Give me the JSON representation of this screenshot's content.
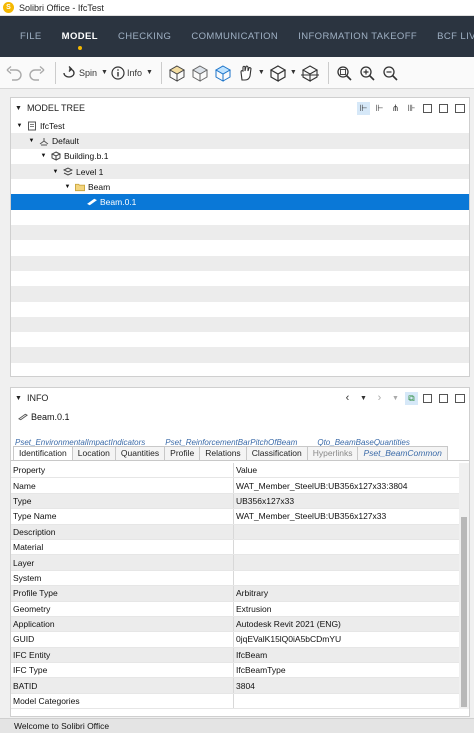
{
  "window": {
    "app_icon_letter": "S",
    "title": "Solibri Office - IfcTest"
  },
  "menu": {
    "items": [
      {
        "label": "FILE",
        "active": false
      },
      {
        "label": "MODEL",
        "active": true
      },
      {
        "label": "CHECKING",
        "active": false
      },
      {
        "label": "COMMUNICATION",
        "active": false
      },
      {
        "label": "INFORMATION TAKEOFF",
        "active": false
      },
      {
        "label": "BCF LIVE CONN",
        "active": false
      }
    ]
  },
  "toolbar": {
    "spin_label": "Spin",
    "info_label": "Info"
  },
  "model_tree": {
    "header": "MODEL TREE",
    "items": [
      {
        "label": "IfcTest",
        "depth": 0,
        "icon": "project-icon"
      },
      {
        "label": "Default",
        "depth": 1,
        "icon": "site-icon"
      },
      {
        "label": "Building.b.1",
        "depth": 2,
        "icon": "building-icon"
      },
      {
        "label": "Level 1",
        "depth": 3,
        "icon": "level-icon"
      },
      {
        "label": "Beam",
        "depth": 4,
        "icon": "folder-icon"
      },
      {
        "label": "Beam.0.1",
        "depth": 5,
        "icon": "beam-icon",
        "selected": true
      }
    ]
  },
  "info": {
    "header": "INFO",
    "selected_name": "Beam.0.1",
    "tabs_row1": [
      "Pset_EnvironmentalImpactIndicators",
      "Pset_ReinforcementBarPitchOfBeam",
      "Qto_BeamBaseQuantities"
    ],
    "tabs_row2": [
      {
        "label": "Identification",
        "style": "active"
      },
      {
        "label": "Location",
        "style": "normal"
      },
      {
        "label": "Quantities",
        "style": "normal"
      },
      {
        "label": "Profile",
        "style": "normal"
      },
      {
        "label": "Relations",
        "style": "normal"
      },
      {
        "label": "Classification",
        "style": "normal"
      },
      {
        "label": "Hyperlinks",
        "style": "dim"
      },
      {
        "label": "Pset_BeamCommon",
        "style": "link"
      }
    ],
    "columns": [
      "Property",
      "Value"
    ],
    "rows": [
      {
        "property": "Name",
        "value": "WAT_Member_SteelUB:UB356x127x33:3804"
      },
      {
        "property": "Type",
        "value": "UB356x127x33"
      },
      {
        "property": "Type Name",
        "value": "WAT_Member_SteelUB:UB356x127x33"
      },
      {
        "property": "Description",
        "value": ""
      },
      {
        "property": "Material",
        "value": ""
      },
      {
        "property": "Layer",
        "value": ""
      },
      {
        "property": "System",
        "value": ""
      },
      {
        "property": "Profile Type",
        "value": "Arbitrary"
      },
      {
        "property": "Geometry",
        "value": "Extrusion"
      },
      {
        "property": "Application",
        "value": "Autodesk Revit 2021 (ENG)"
      },
      {
        "property": "GUID",
        "value": "0jqEValK15lQ0iA5bCDmYU"
      },
      {
        "property": "IFC Entity",
        "value": "IfcBeam"
      },
      {
        "property": "IFC Type",
        "value": "IfcBeamType"
      },
      {
        "property": "BATID",
        "value": "3804"
      },
      {
        "property": "Model Categories",
        "value": ""
      }
    ]
  },
  "status": {
    "message": "Welcome to Solibri Office"
  }
}
